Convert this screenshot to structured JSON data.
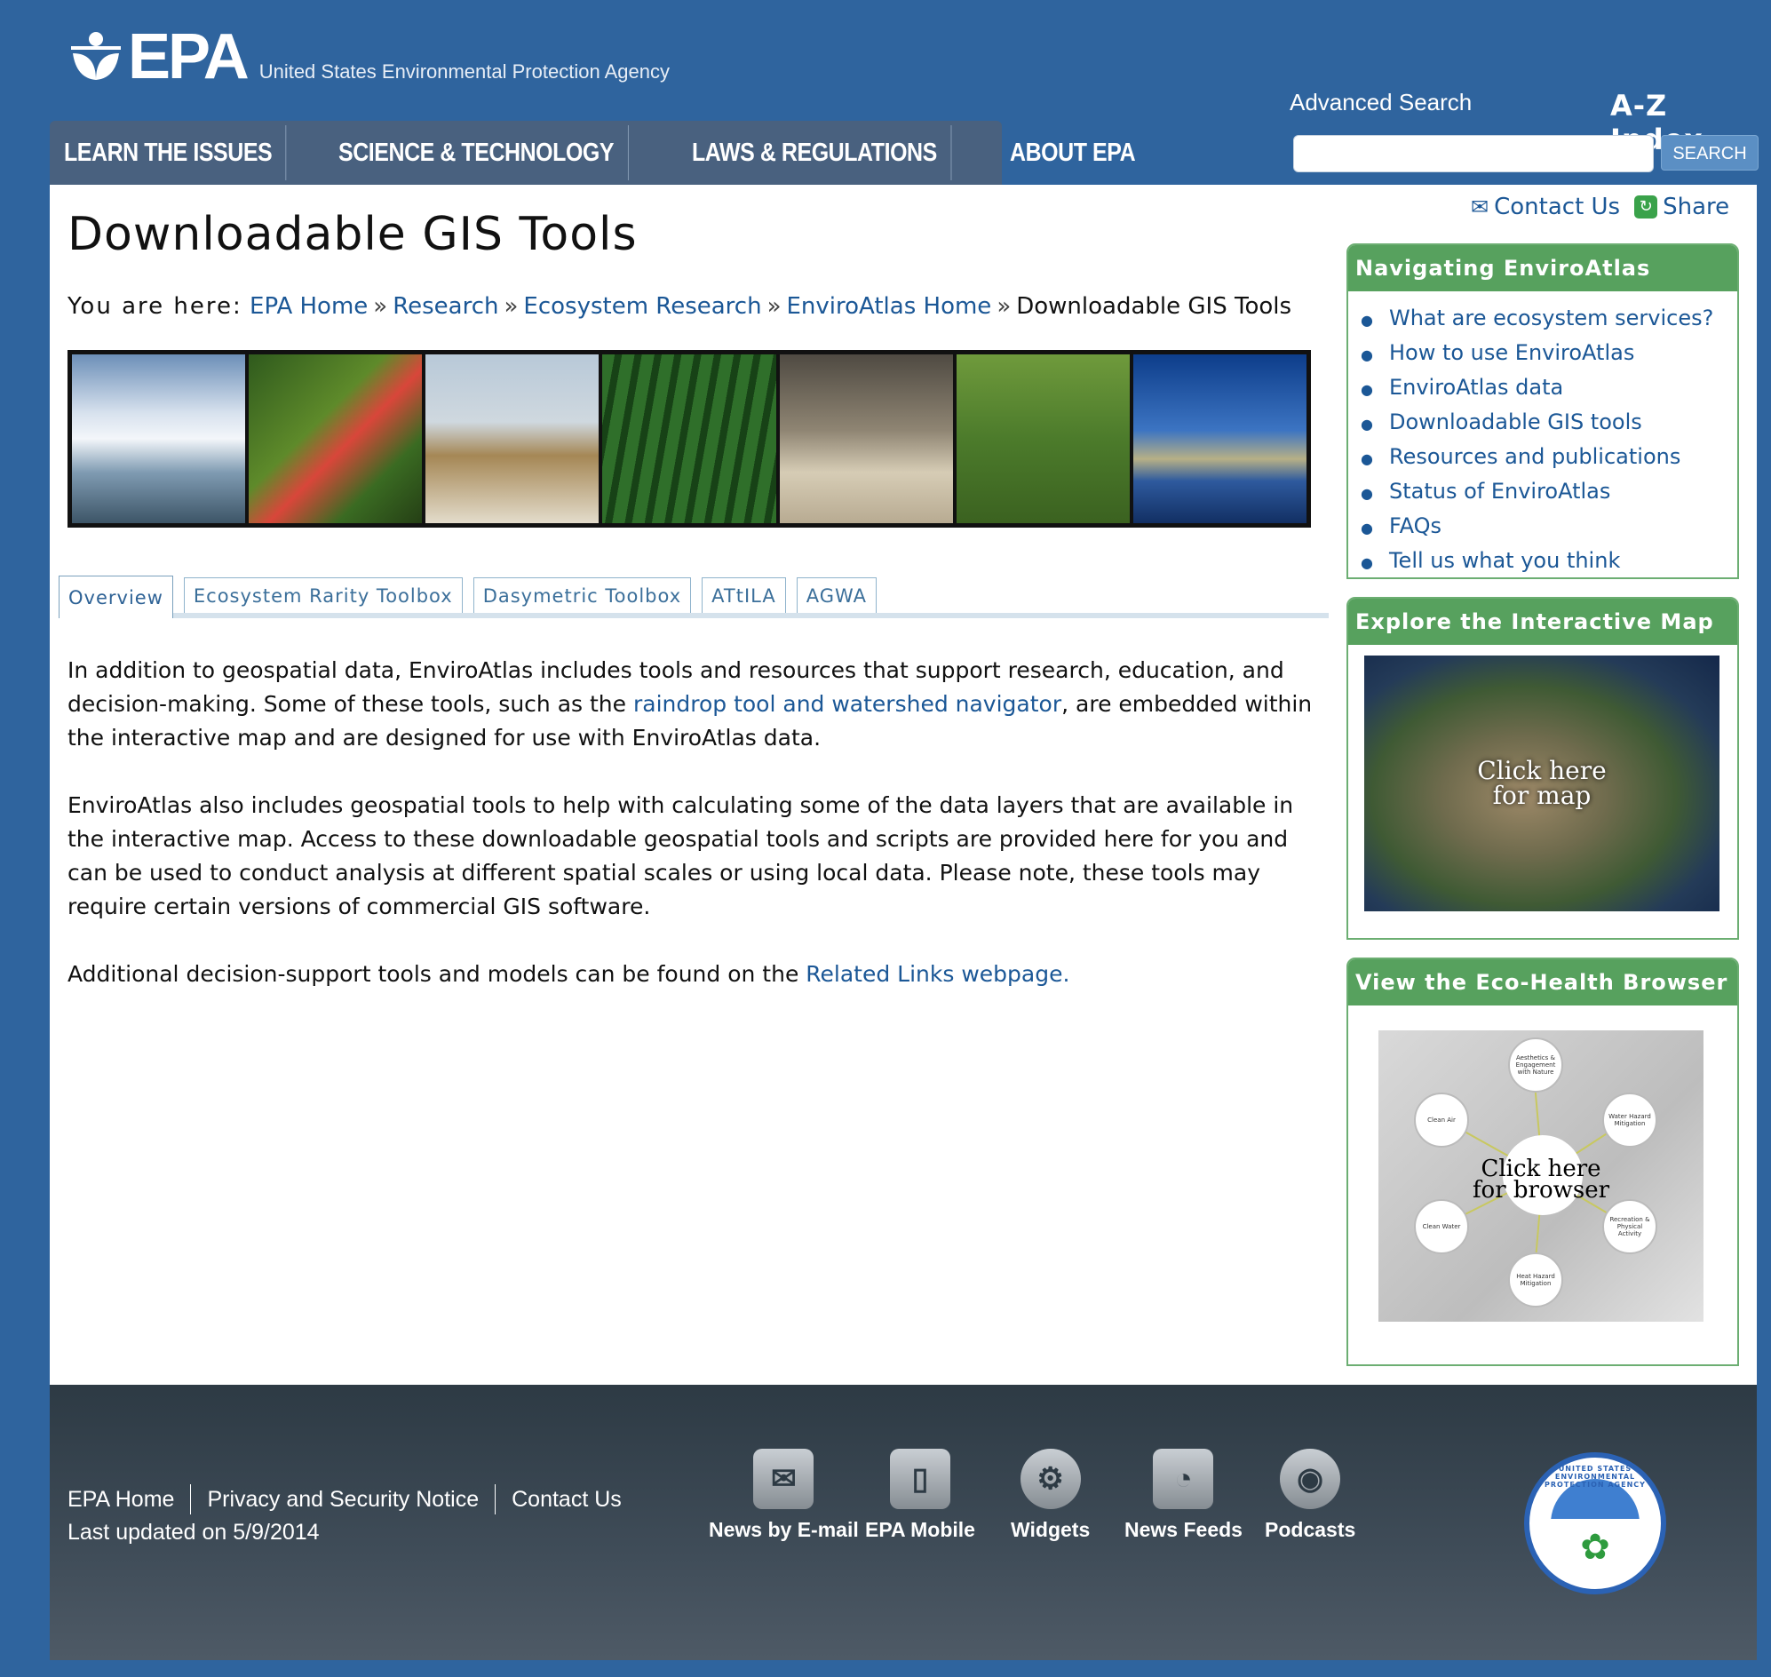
{
  "header": {
    "logo_text": "EPA",
    "agency_name": "United States Environmental Protection Agency",
    "nav": [
      "LEARN THE ISSUES",
      "SCIENCE & TECHNOLOGY",
      "LAWS & REGULATIONS",
      "ABOUT EPA"
    ],
    "advanced_search": "Advanced Search",
    "az_index": "A-Z Index",
    "search_placeholder": "",
    "search_button": "SEARCH"
  },
  "page": {
    "title": "Downloadable GIS Tools",
    "breadcrumb": {
      "prefix": "You are here:",
      "items": [
        "EPA Home",
        "Research",
        "Ecosystem Research",
        "EnviroAtlas Home"
      ],
      "current": "Downloadable GIS Tools"
    },
    "tabs": [
      "Overview",
      "Ecosystem Rarity Toolbox",
      "Dasymetric Toolbox",
      "ATtILA",
      "AGWA"
    ],
    "active_tab": "Overview",
    "paragraphs": {
      "p1_before": "In addition to geospatial data, EnviroAtlas includes tools and resources that support research, education, and decision-making. Some of these tools, such as the ",
      "p1_link": "raindrop tool and watershed navigator",
      "p1_after": ", are embedded within the interactive map and are designed for use with EnviroAtlas data.",
      "p2": "EnviroAtlas also includes geospatial tools to help with calculating some of the data layers that are available in the interactive map. Access to these downloadable geospatial tools and scripts are provided here for you and can be used to conduct analysis at different spatial scales or using local data. Please note, these tools may require certain versions of commercial GIS software.",
      "p3_before": "Additional decision-support tools and models can be found on the ",
      "p3_link": "Related Links webpage."
    }
  },
  "sidebar": {
    "contact": "Contact Us",
    "share": "Share",
    "nav_box": {
      "title": "Navigating EnviroAtlas",
      "items": [
        "What are ecosystem services?",
        "How to use EnviroAtlas",
        "EnviroAtlas data",
        "Downloadable GIS tools",
        "Resources and publications",
        "Status of EnviroAtlas",
        "FAQs",
        "Tell us what you think"
      ]
    },
    "map_box": {
      "title": "Explore the Interactive Map",
      "label_line1": "Click here",
      "label_line2": "for map"
    },
    "eco_box": {
      "title": "View the Eco-Health Browser",
      "label_line1": "Click here",
      "label_line2": "for browser",
      "nodes": [
        "Aesthetics & Engagement with Nature",
        "Clean Air",
        "Water Hazard Mitigation",
        "Clean Water",
        "Recreation & Physical Activity",
        "Heat Hazard Mitigation"
      ]
    }
  },
  "footer": {
    "links": [
      "EPA Home",
      "Privacy and Security Notice",
      "Contact Us"
    ],
    "last_updated": "Last updated on 5/9/2014",
    "icons": [
      "News by E-mail",
      "EPA Mobile",
      "Widgets",
      "News Feeds",
      "Podcasts"
    ],
    "seal_text": "UNITED STATES ENVIRONMENTAL PROTECTION AGENCY"
  },
  "colors": {
    "page_bg": "#2f649e",
    "nav_bg": "#49617f",
    "link": "#1b5796",
    "sidebar_head": "#57a15e",
    "footer_bg": "#3f4c58"
  }
}
